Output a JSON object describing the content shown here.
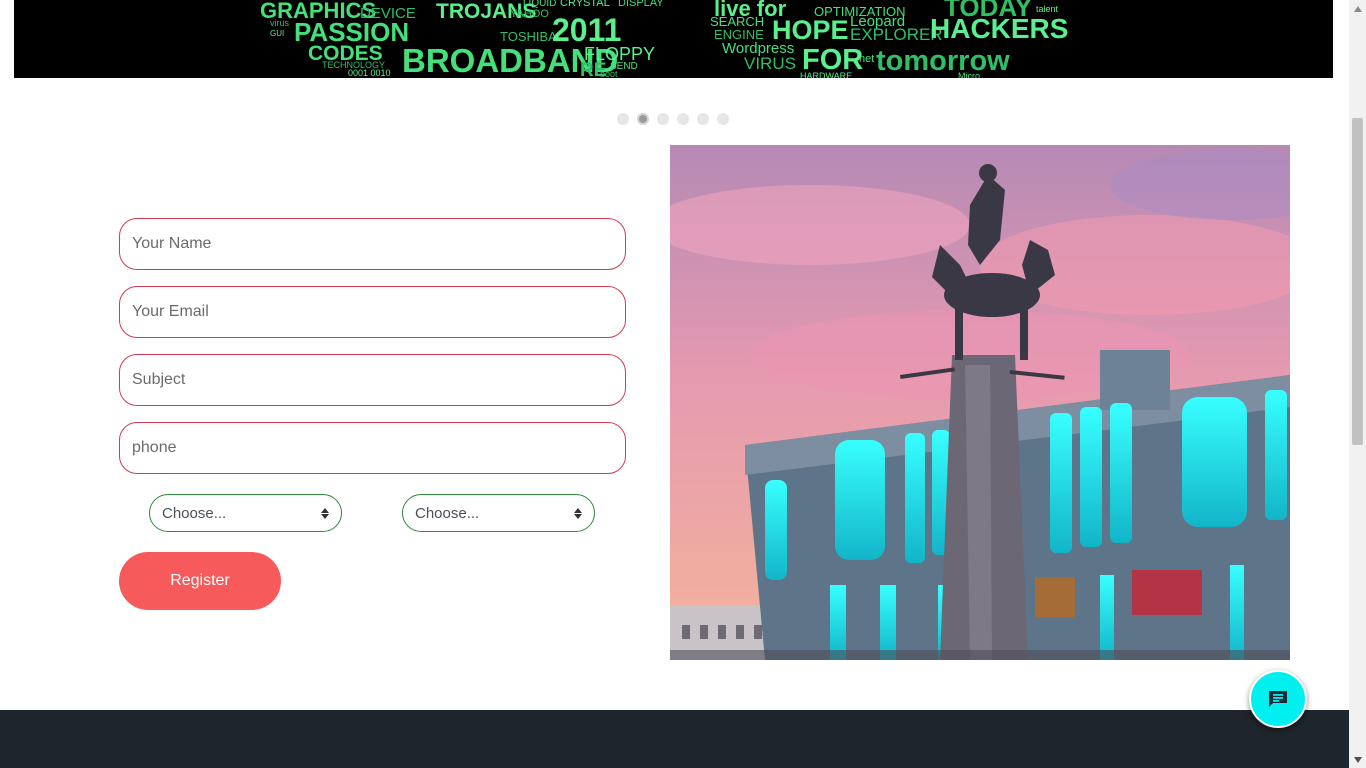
{
  "banner": {
    "words": [
      "GRAPHICS",
      "DEVICE",
      "TROJANS",
      "LIQUID",
      "YAHOO",
      "CRYSTAL",
      "DISPLAY",
      "virus",
      "GUI",
      "PASSION",
      "TOSHIBA",
      "2011",
      "CODES",
      "TECHNOLOGY",
      "0001 0010",
      "BROADBAND",
      "RE",
      "FLOPPY",
      "SEND",
      "boot",
      "live for",
      "OPTIMIZATION",
      "TODAY",
      "talent",
      "SEARCH",
      "ENGINE",
      "HOPE",
      "Leopard",
      "EXPLORER",
      "HACKERS",
      "Wordpress",
      "VIRUS",
      "FOR",
      ".net",
      "tomorrow",
      "HARDWARE",
      "Micro"
    ]
  },
  "carousel": {
    "slides": 6,
    "active_index": 1
  },
  "form": {
    "name_placeholder": "Your Name",
    "email_placeholder": "Your Email",
    "subject_placeholder": "Subject",
    "phone_placeholder": "phone",
    "select_left": "Choose...",
    "select_right": "Choose...",
    "register_label": "Register"
  },
  "colors": {
    "field_border": "#d13b52",
    "select_border": "#2e8b3a",
    "register_bg": "#f75a5a",
    "footer_bg": "#1f252c",
    "chat_bg": "#00f0f0"
  },
  "icons": {
    "chat": "chat-message-icon"
  }
}
